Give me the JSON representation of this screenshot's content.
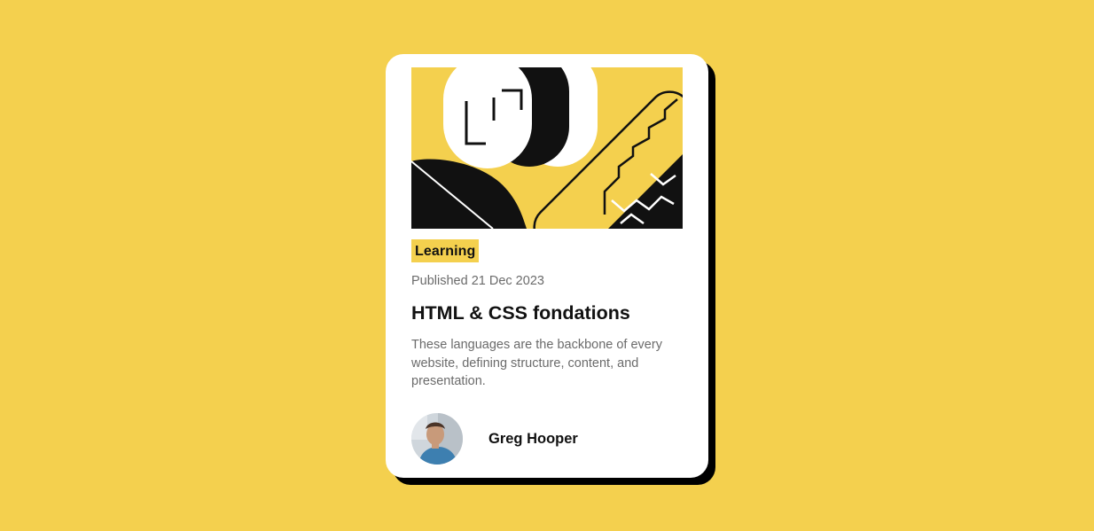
{
  "colors": {
    "background": "#F4D04E",
    "card": "#FFFFFF",
    "text_primary": "#111111",
    "text_secondary": "#6B6B6B",
    "shadow": "#000000"
  },
  "card": {
    "tag": "Learning",
    "published": "Published 21 Dec 2023",
    "title": "HTML & CSS fondations",
    "description": "These languages are the backbone of every website, defining structure, content, and presentation.",
    "author": {
      "name": "Greg Hooper",
      "avatar_icon": "author-avatar"
    },
    "illustration_icon": "abstract-illustration"
  }
}
